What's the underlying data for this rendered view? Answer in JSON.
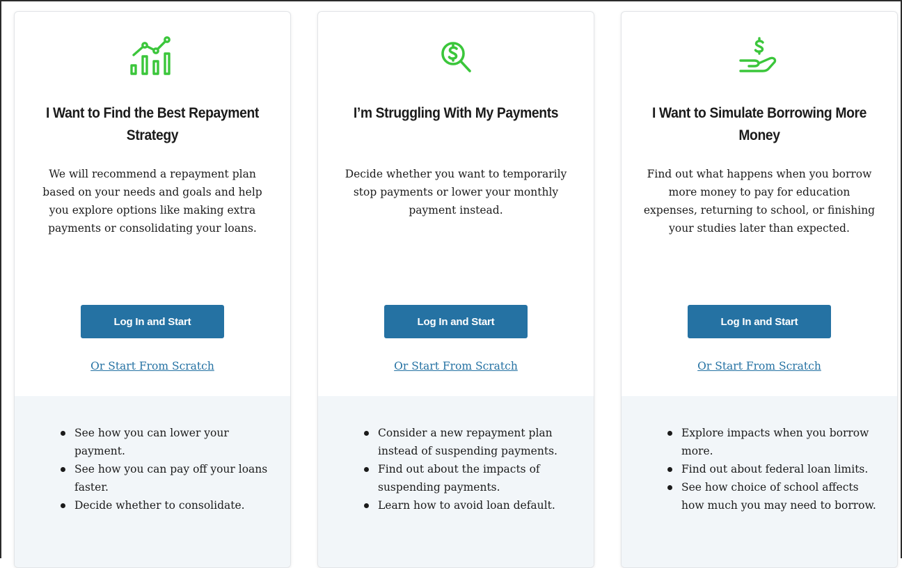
{
  "colors": {
    "icon_green": "#3bc63b",
    "button_blue": "#2572a3",
    "link_blue": "#2572a3",
    "bottom_panel": "#f2f6f9"
  },
  "cards": [
    {
      "icon": "chart-bars-trend-icon",
      "title": "I Want to Find the Best Repayment Strategy",
      "description": "We will recommend a repayment plan based on your needs and goals and help you explore options like making extra payments or consolidating your loans.",
      "button_label": "Log In and Start",
      "link_label": "Or Start From Scratch",
      "bullets": [
        "See how you can lower your payment.",
        "See how you can pay off your loans faster.",
        "Decide whether to consolidate."
      ]
    },
    {
      "icon": "dollar-magnifier-icon",
      "title": "I’m Struggling With My Payments",
      "description": "Decide whether you want to temporarily stop payments or lower your monthly payment instead.",
      "button_label": "Log In and Start",
      "link_label": "Or Start From Scratch",
      "bullets": [
        "Consider a new repayment plan instead of suspending payments.",
        "Find out about the impacts of suspending payments.",
        "Learn how to avoid loan default."
      ]
    },
    {
      "icon": "hand-dollar-icon",
      "title": "I Want to Simulate Borrowing More Money",
      "description": "Find out what happens when you borrow more money to pay for education expenses, returning to school, or finishing your studies later than expected.",
      "button_label": "Log In and Start",
      "link_label": "Or Start From Scratch",
      "bullets": [
        "Explore impacts when you borrow more.",
        "Find out about federal loan limits.",
        "See how choice of school affects how much you may need to borrow."
      ]
    }
  ]
}
